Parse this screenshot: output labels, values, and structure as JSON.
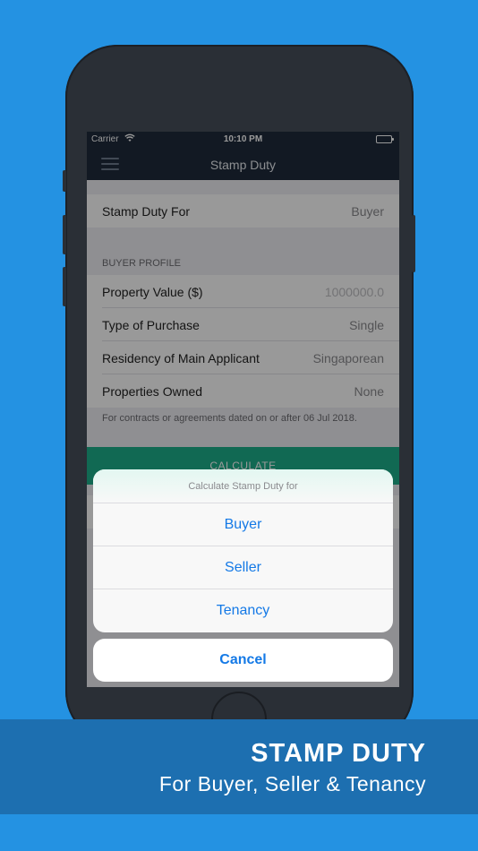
{
  "status_bar": {
    "carrier": "Carrier",
    "time": "10:10 PM"
  },
  "nav": {
    "title": "Stamp Duty"
  },
  "form": {
    "stamp_duty_for": {
      "label": "Stamp Duty For",
      "value": "Buyer"
    },
    "buyer_profile_header": "BUYER PROFILE",
    "property_value": {
      "label": "Property Value ($)",
      "value": "1000000.0"
    },
    "type_of_purchase": {
      "label": "Type of Purchase",
      "value": "Single"
    },
    "residency": {
      "label": "Residency of Main Applicant",
      "value": "Singaporean"
    },
    "properties_owned": {
      "label": "Properties Owned",
      "value": "None"
    },
    "footnote": "For contracts or agreements dated on or after 06 Jul 2018.",
    "calculate_label": "CALCULATE"
  },
  "action_sheet": {
    "title": "Calculate Stamp Duty for",
    "options": [
      "Buyer",
      "Seller",
      "Tenancy"
    ],
    "cancel": "Cancel"
  },
  "banner": {
    "headline": "STAMP DUTY",
    "subtitle": "For Buyer, Seller & Tenancy"
  },
  "colors": {
    "background": "#2492E2",
    "navbar": "#1E2A3B",
    "accent_blue": "#1479E6",
    "calculate_green": "#1DAF8A",
    "banner": "#1D6FB0"
  }
}
